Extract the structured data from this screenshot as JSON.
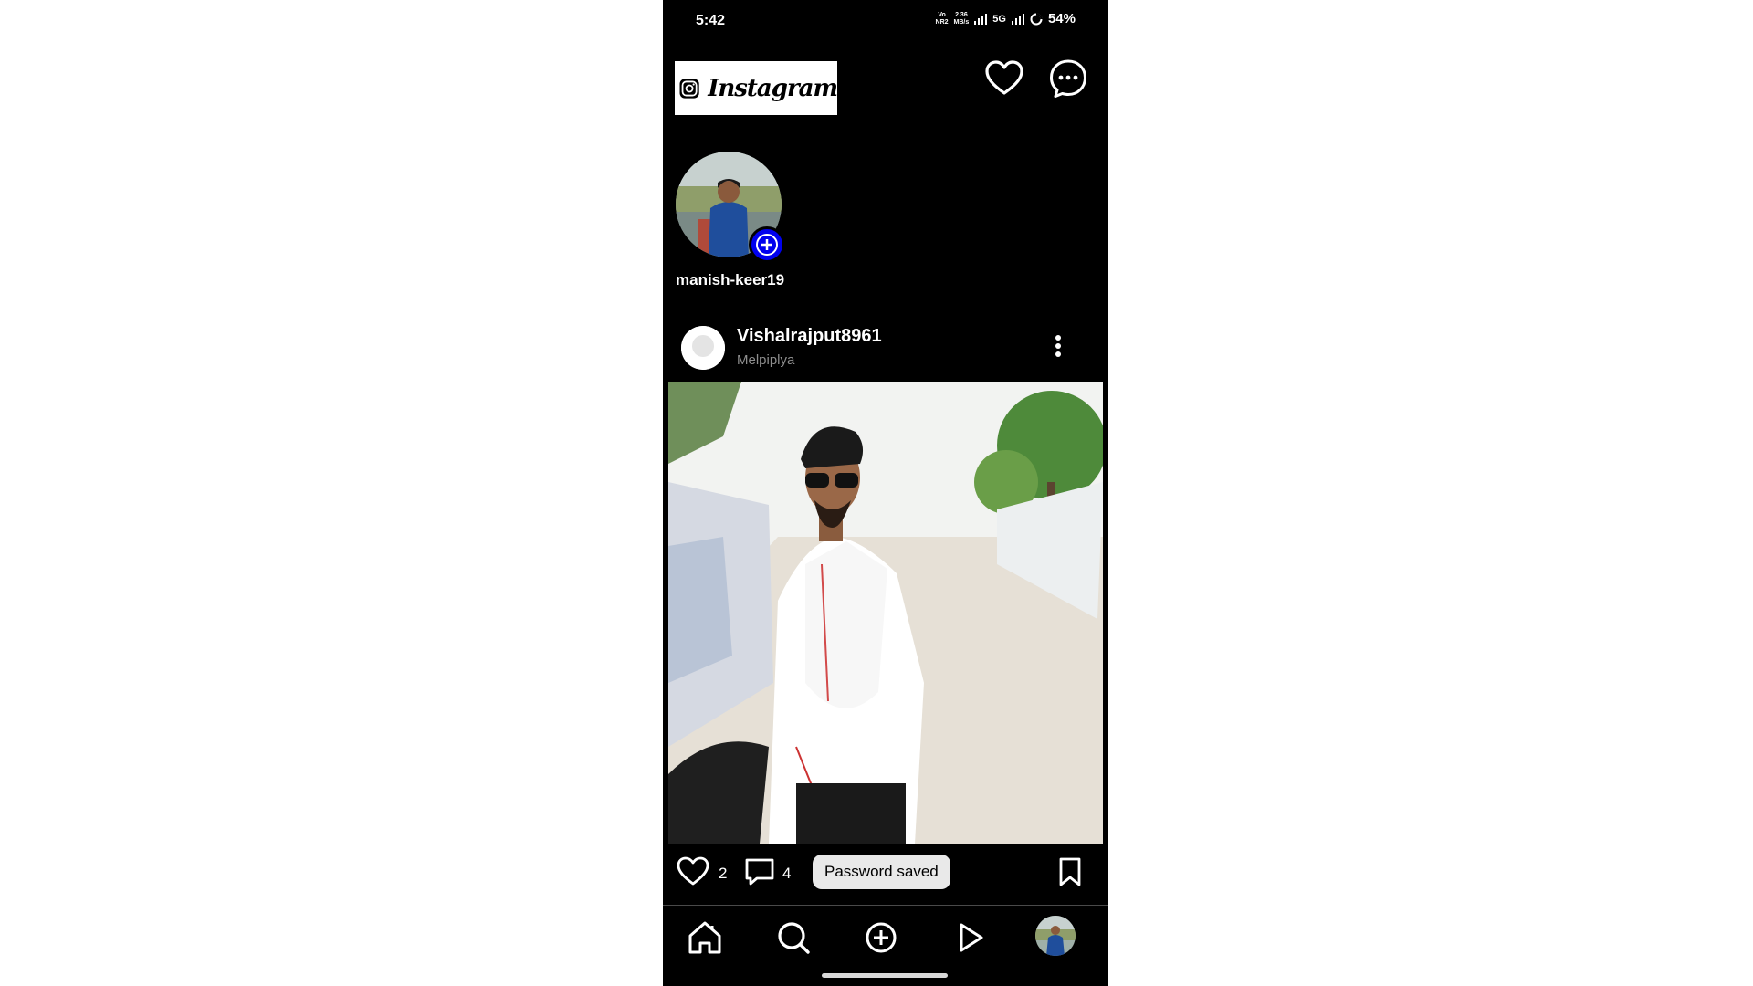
{
  "status_bar": {
    "time": "5:42",
    "volte_top": "Vo",
    "volte_bottom": "NR2",
    "speed_top": "2.36",
    "speed_bottom": "MB/s",
    "network": "5G",
    "battery": "54%"
  },
  "header": {
    "logo_text": "Instagram",
    "icons": [
      "heart-icon",
      "messenger-icon"
    ]
  },
  "story": {
    "username": "manish-keer19"
  },
  "post": {
    "username": "Vishalrajput8961",
    "location": "Melpiplya",
    "likes": "2",
    "comments": "4"
  },
  "toast": {
    "text": "Password saved"
  },
  "bottom_nav": {
    "items": [
      "home-icon",
      "search-icon",
      "create-icon",
      "reels-icon",
      "profile-avatar"
    ]
  },
  "colors": {
    "background": "#000000",
    "accent_add": "#0000ee",
    "secondary_text": "#8e8e8e"
  }
}
